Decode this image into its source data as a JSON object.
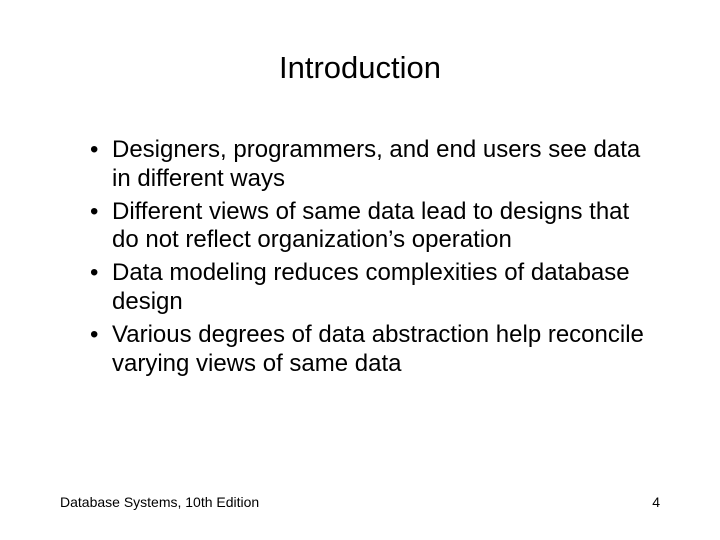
{
  "slide": {
    "title": "Introduction",
    "bullets": [
      "Designers, programmers, and end users see data in different ways",
      "Different views of same data lead to designs that do not reflect organization’s operation",
      "Data modeling reduces complexities of database design",
      "Various degrees of data abstraction help reconcile varying views of same data"
    ],
    "footer": "Database Systems, 10th Edition",
    "page_number": "4"
  }
}
